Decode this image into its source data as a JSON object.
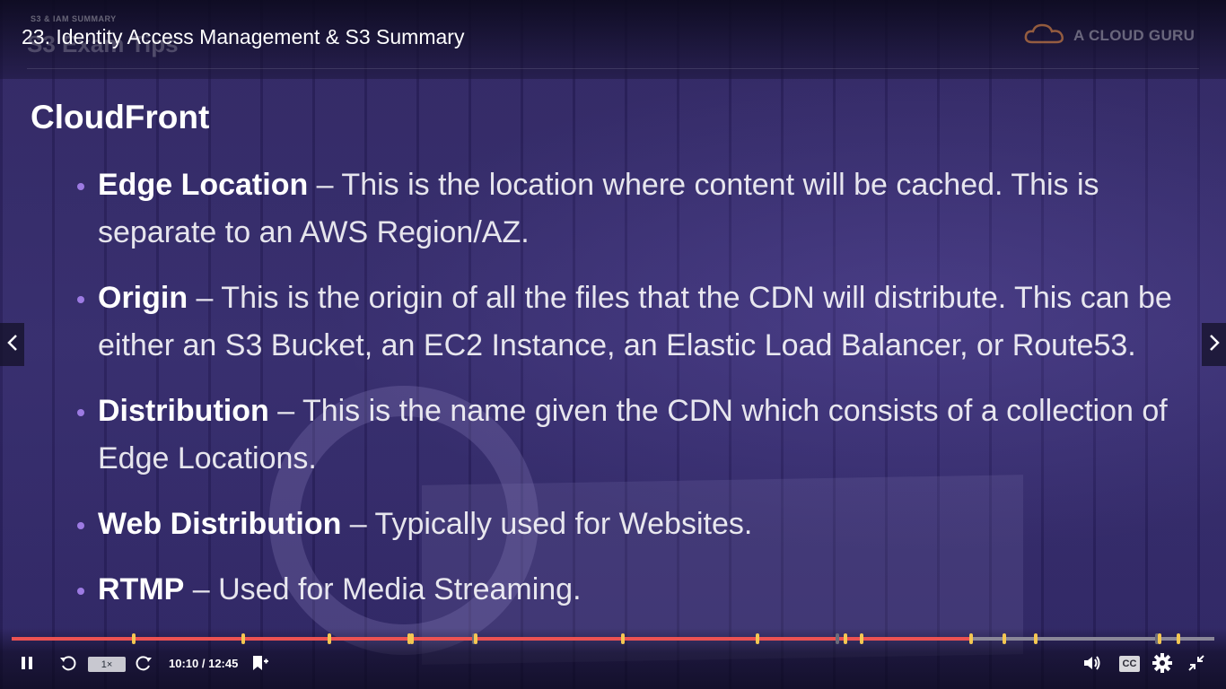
{
  "header": {
    "video_title": "23. Identity Access Management & S3 Summary",
    "slide_kicker": "S3 & IAM SUMMARY",
    "slide_heading": "S3 Exam Tips",
    "brand_text": "A CLOUD GURU"
  },
  "slide": {
    "section_title": "CloudFront",
    "bullets": [
      {
        "term": "Edge Location",
        "text": " – This is the location where content will be cached. This is separate to an AWS Region/AZ."
      },
      {
        "term": "Origin",
        "text": " – This is the origin of all the files that the CDN will distribute. This can be either an S3 Bucket, an EC2 Instance, an Elastic Load Balancer, or Route53."
      },
      {
        "term": "Distribution",
        "text": " – This is the name given the CDN which consists of a collection of Edge Locations."
      },
      {
        "term": "Web Distribution",
        "text": " – Typically used for Websites."
      },
      {
        "term": "RTMP",
        "text": " – Used for Media Streaming."
      }
    ]
  },
  "player": {
    "speed": "1×",
    "time": "10:10 / 12:45",
    "cc_label": "CC",
    "progress_fraction": 0.7974,
    "bookmarks_fraction": [
      0.1,
      0.191,
      0.263,
      0.329,
      0.331,
      0.384,
      0.507,
      0.619,
      0.692,
      0.705,
      0.796,
      0.824,
      0.85,
      0.953,
      0.969
    ],
    "gray_bookmarks_fraction": [
      0.383,
      0.685,
      0.951
    ],
    "colors": {
      "progress_fill": "#ec5252",
      "progress_track": "#8a8798",
      "bookmark": "#f4c752",
      "bullet_dot": "#9d7be3"
    },
    "icons": {
      "pause": "pause-icon",
      "rewind": "rewind-5s-icon",
      "forward": "forward-5s-icon",
      "bookmark_add": "add-bookmark-icon",
      "volume": "volume-icon",
      "settings": "gear-icon",
      "fullscreen_exit": "exit-fullscreen-icon",
      "prev": "chevron-left-icon",
      "next": "chevron-right-icon",
      "brand_logo": "cloud-logo-icon"
    }
  }
}
